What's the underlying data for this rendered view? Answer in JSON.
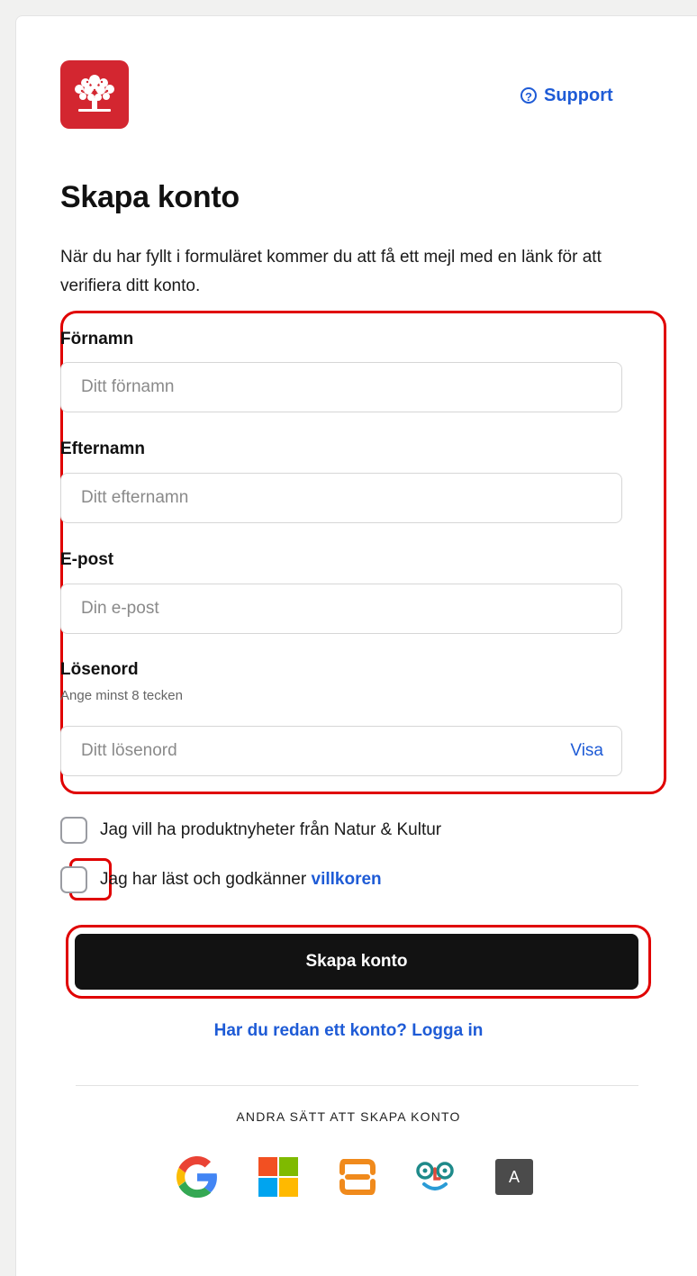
{
  "header": {
    "logo_icon": "tree-logo-icon",
    "support_label": "Support"
  },
  "title": "Skapa konto",
  "intro": "När du har fyllt i formuläret kommer du att få ett mejl med en länk för att verifiera ditt konto.",
  "form": {
    "first_name": {
      "label": "Förnamn",
      "placeholder": "Ditt förnamn"
    },
    "last_name": {
      "label": "Efternamn",
      "placeholder": "Ditt efternamn"
    },
    "email": {
      "label": "E-post",
      "placeholder": "Din e-post"
    },
    "password": {
      "label": "Lösenord",
      "hint": "Ange minst 8 tecken",
      "placeholder": "Ditt lösenord",
      "show_label": "Visa"
    }
  },
  "checkboxes": {
    "newsletter_label": "Jag vill ha produktnyheter från Natur & Kultur",
    "terms_prefix": "Jag har läst och godkänner",
    "terms_link": "villkoren"
  },
  "submit_label": "Skapa konto",
  "login_link": "Har du redan ett konto? Logga in",
  "alternatives": {
    "title": "ANDRA SÄTT ATT SKAPA KONTO",
    "providers": [
      "google-icon",
      "microsoft-icon",
      "skolon-icon",
      "face-logo-icon",
      "a-icon"
    ],
    "a_label": "A"
  },
  "colors": {
    "brand_red": "#d32630",
    "link_blue": "#1e5bd6",
    "button_black": "#121212",
    "highlight_red": "#e00000"
  }
}
